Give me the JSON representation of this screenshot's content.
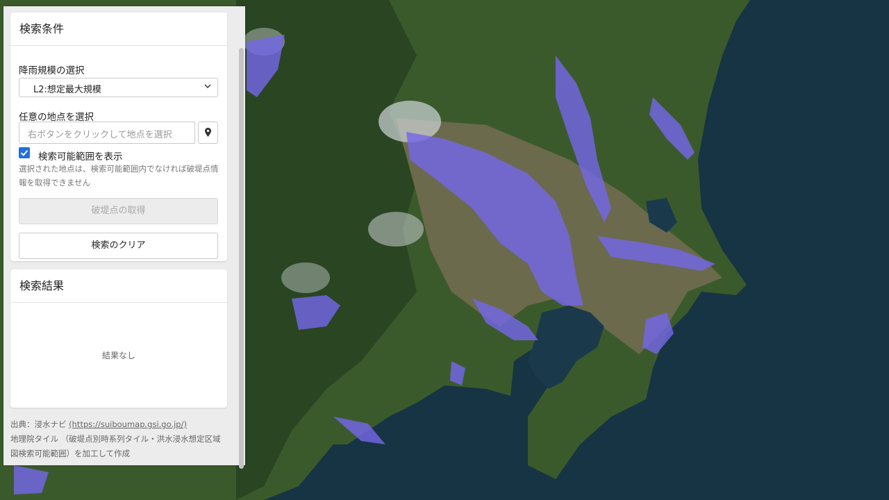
{
  "search_conditions": {
    "title": "検索条件",
    "rainfall_label": "降雨規模の選択",
    "rainfall_selected": "L2:想定最大規模",
    "point_label": "任意の地点を選択",
    "point_placeholder": "右ボタンをクリックして地点を選択",
    "show_range_label": "検索可能範囲を表示",
    "show_range_checked": true,
    "hint_text": "選択された地点は、検索可能範囲内でなければ破堤点情報を取得できません",
    "get_breach_button": "破堤点の取得",
    "clear_button": "検索のクリア"
  },
  "results": {
    "title": "検索結果",
    "empty_text": "結果なし"
  },
  "credits": {
    "source_prefix": "出典：浸水ナビ ",
    "source_link": "(https://suiboumap.gsi.go.jp/)",
    "tiles_text": "地理院タイル （破堤点別時系列タイル・洪水浸水想定区域図検索可能範囲）を加工して作成"
  },
  "icons": {
    "select_chevron": "chevron-down-icon",
    "map_pin": "map-pin-icon",
    "checkbox": "checkmark-icon"
  },
  "colors": {
    "flood_overlay": "#7467e6",
    "checkbox_accent": "#1f6fe0"
  }
}
